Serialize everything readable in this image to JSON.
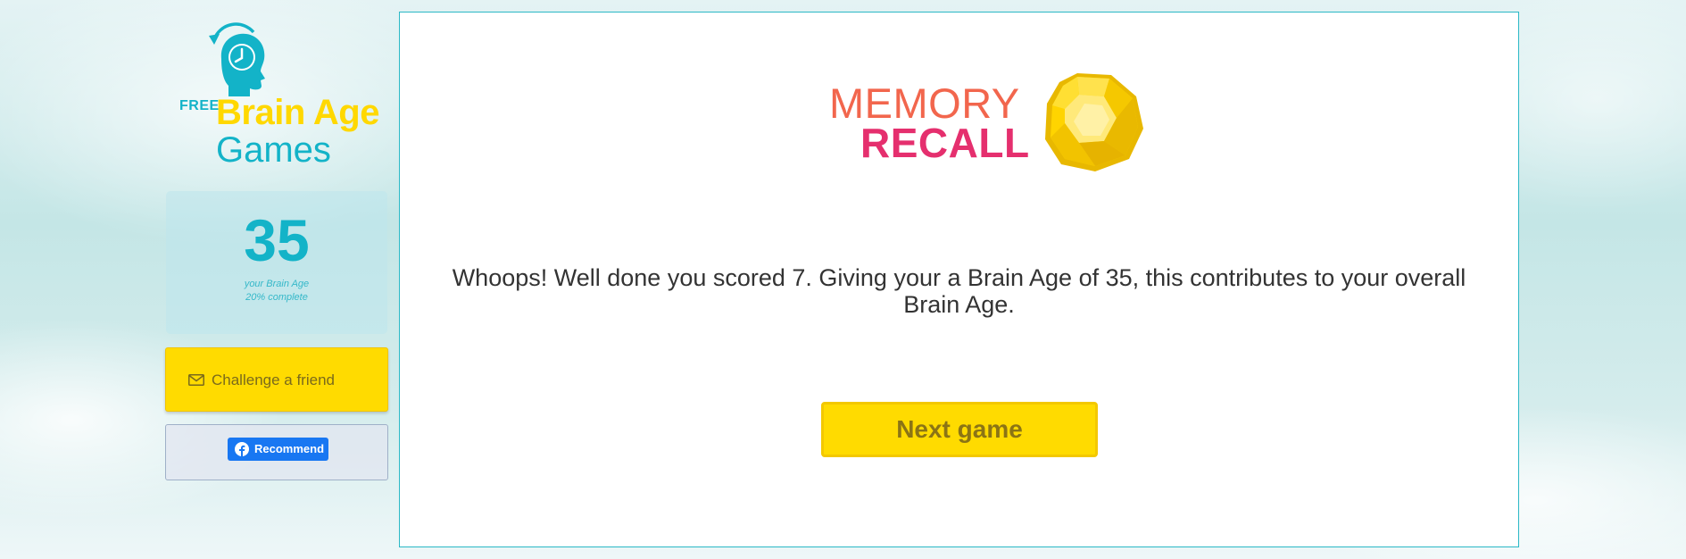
{
  "sidebar": {
    "logo": {
      "free": "FREE",
      "brain_age": "Brain Age",
      "games": "Games",
      "icon": "head-clock-icon"
    },
    "brain_age_card": {
      "value": "35",
      "label": "your Brain Age",
      "progress_text": "20% complete",
      "progress": 0.2
    },
    "challenge_button": {
      "label": "Challenge a friend",
      "icon": "mail-icon"
    },
    "facebook": {
      "label": "Recommend",
      "icon": "facebook-icon"
    }
  },
  "main": {
    "game_logo": {
      "line1": "MEMORY",
      "line2": "RECALL",
      "icon": "yellow-gem-icon"
    },
    "result_text": "Whoops! Well done you scored 7. Giving your a Brain Age of 35, this contributes to your overall Brain Age.",
    "next_button_label": "Next game"
  },
  "colors": {
    "accent_teal": "#13b3c8",
    "brand_yellow": "#ffdb00",
    "memory_orange": "#f2664d",
    "recall_pink": "#e52f6e",
    "facebook_blue": "#1877f2"
  }
}
